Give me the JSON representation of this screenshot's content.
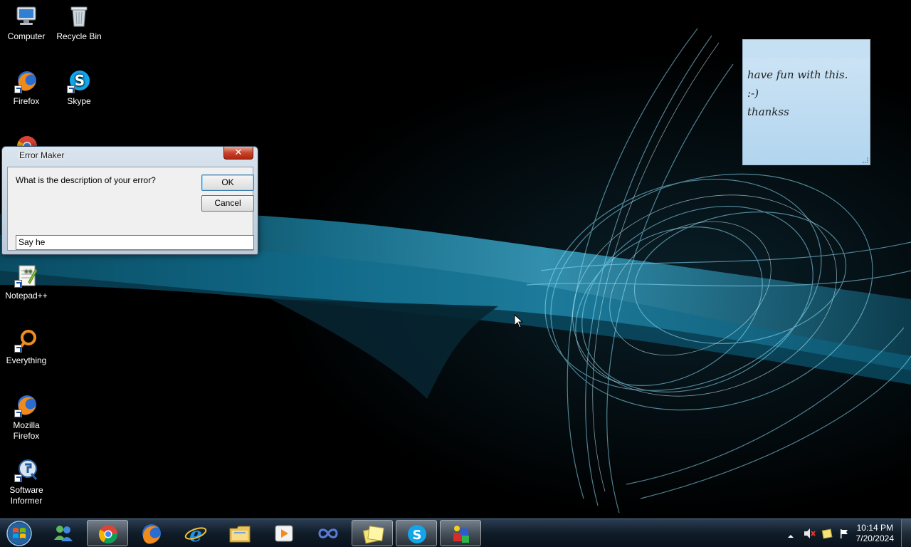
{
  "desktop": {
    "icons": [
      {
        "label": "Computer",
        "icon": "computer-icon"
      },
      {
        "label": "Recycle Bin",
        "icon": "recycle-bin-icon"
      },
      {
        "label": "Firefox",
        "icon": "firefox-icon"
      },
      {
        "label": "Skype",
        "icon": "skype-icon"
      },
      {
        "label": "Notepad++",
        "icon": "notepad-plus-plus-icon"
      },
      {
        "label": "Everything",
        "icon": "everything-search-icon"
      },
      {
        "label": "Mozilla Firefox",
        "icon": "firefox-icon"
      },
      {
        "label": "Software Informer",
        "icon": "software-informer-icon"
      }
    ]
  },
  "dialog": {
    "title": "Error Maker",
    "close_label": "✕",
    "prompt": "What is the description of your error?",
    "ok_label": "OK",
    "cancel_label": "Cancel",
    "input_value": "Say he"
  },
  "sticky_note": {
    "lines": [
      "have fun with this.",
      ":-)",
      "thankss"
    ]
  },
  "taskbar": {
    "apps": [
      {
        "name": "Windows Live Messenger",
        "icon": "messenger-icon",
        "active": false
      },
      {
        "name": "Google Chrome",
        "icon": "chrome-icon",
        "active": true
      },
      {
        "name": "Firefox",
        "icon": "firefox-icon",
        "active": false
      },
      {
        "name": "Internet Explorer",
        "icon": "internet-explorer-icon",
        "active": false
      },
      {
        "name": "Windows Explorer",
        "icon": "folder-icon",
        "active": false
      },
      {
        "name": "Media Player",
        "icon": "media-player-icon",
        "active": false
      },
      {
        "name": "Infinity",
        "icon": "infinity-icon",
        "active": false
      },
      {
        "name": "Sticky Notes",
        "icon": "sticky-notes-icon",
        "active": true
      },
      {
        "name": "Skype",
        "icon": "skype-icon",
        "active": true
      },
      {
        "name": "Error Maker",
        "icon": "error-maker-icon",
        "active": true
      }
    ],
    "clock": {
      "time": "10:14 PM",
      "date": "7/20/2024"
    }
  },
  "colors": {
    "wallpaper_accent": "#3fb2d6",
    "sticky_bg": "#c4dff2"
  }
}
